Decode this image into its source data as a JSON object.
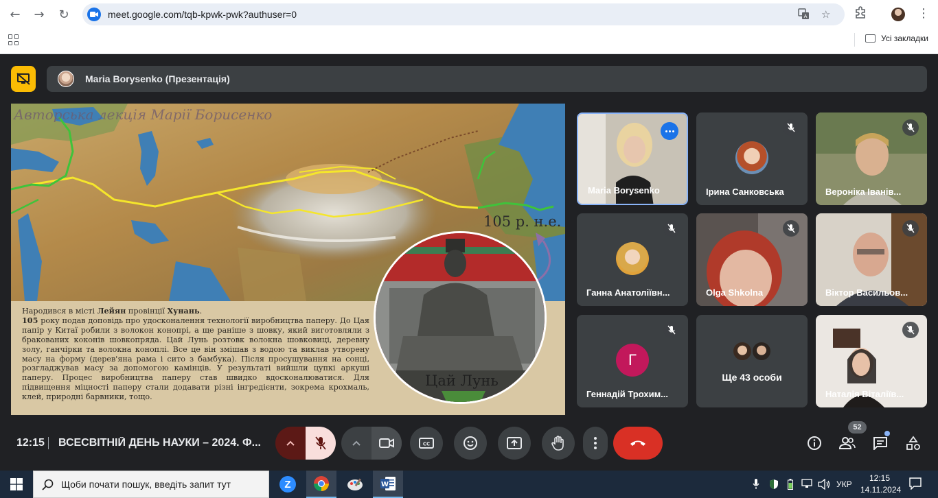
{
  "browser": {
    "url": "meet.google.com/tqb-kpwk-pwk?authuser=0",
    "bookmarks_label": "Усі закладки"
  },
  "meet": {
    "presenter_banner": "Maria Borysenko (Презентація)",
    "time": "12:15",
    "meeting_title": "ВСЕСВІТНІЙ ДЕНЬ НАУКИ – 2024. Ф...",
    "participants_count": "52",
    "end_call_color": "#d93025",
    "participants": [
      {
        "name": "Maria Borysenko",
        "muted": false,
        "video": true
      },
      {
        "name": "Ірина Санковська",
        "muted": true,
        "video": false
      },
      {
        "name": "Вероніка Іванів...",
        "muted": true,
        "video": true
      },
      {
        "name": "Ганна Анатоліївн...",
        "muted": true,
        "video": false
      },
      {
        "name": "Olga Shkolna",
        "muted": true,
        "video": true
      },
      {
        "name": "Віктор Васильов...",
        "muted": true,
        "video": true
      },
      {
        "name": "Геннадій Трохим...",
        "muted": true,
        "video": false,
        "initial": "Г"
      },
      {
        "name": "Ще 43 особи",
        "muted": false,
        "video": false
      },
      {
        "name": "Наталія Віталіїв...",
        "muted": true,
        "video": true
      }
    ]
  },
  "slide": {
    "header": "Авторська лекція Марії Борисенко",
    "year_label": "105 р. н.е.",
    "caption": "Цай Лунь",
    "text_runs": {
      "p1a": "Народився в місті ",
      "p1b": "Лейян",
      "p1c": " провінції ",
      "p1d": "Хунань",
      "p1e": ".",
      "p2a": "105",
      "p2b": " року подав доповідь про удосконалення технології виробництва паперу. До Цая папір у Китаї робили з волокон конопрі, а ще раніше з шовку, який виготовляли з бракованих коконів шовкопряда. Цай Лунь розтовк волокна шовковиці, деревну золу, ганчірки та волокна коноплі. Все це він змішав з водою та виклав утворену масу на форму (дерев'яна рама і сито з бамбука). Після просушування на сонці, розгладжував масу за допомогою камінців. У результаті вийшли цупкі аркуші паперу. Процес виробництва паперу став швидко вдосконалюватися. Для підвищення міцності паперу стали додавати різні інгредієнти, зокрема крохмаль, клей, природні барвники, тощо."
    }
  },
  "taskbar": {
    "search_placeholder": "Щоби почати пошук, введіть запит тут",
    "language": "УКР",
    "clock_time": "12:15",
    "clock_date": "14.11.2024"
  }
}
